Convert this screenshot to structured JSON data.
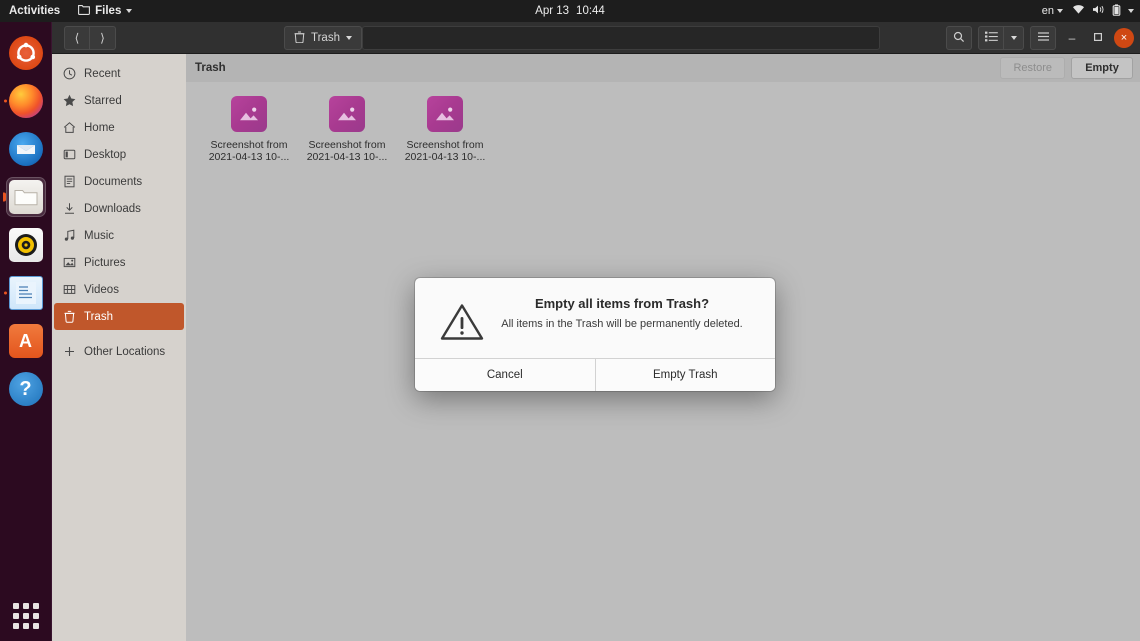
{
  "topbar": {
    "activities": "Activities",
    "app_menu": "Files",
    "app_icon": "folder-icon",
    "clock_date": "Apr 13",
    "clock_time": "10:44",
    "language": "en",
    "tray_icons": [
      "wifi-icon",
      "volume-icon",
      "battery-icon"
    ]
  },
  "dock": {
    "items": [
      {
        "name": "ubuntu-desktop-icon",
        "label": "Ubuntu"
      },
      {
        "name": "firefox-icon",
        "label": "Firefox"
      },
      {
        "name": "thunderbird-icon",
        "label": "Thunderbird"
      },
      {
        "name": "files-icon",
        "label": "Files"
      },
      {
        "name": "rhythmbox-icon",
        "label": "Rhythmbox"
      },
      {
        "name": "libreoffice-writer-icon",
        "label": "LibreOffice Writer"
      },
      {
        "name": "ubuntu-software-icon",
        "label": "Ubuntu Software",
        "glyph": "A"
      },
      {
        "name": "help-icon",
        "label": "Help",
        "glyph": "?"
      }
    ],
    "show_apps_label": "Show Applications"
  },
  "window": {
    "headerbar": {
      "back_icon": "chevron-left-icon",
      "forward_icon": "chevron-right-icon",
      "pathbar_label": "Trash",
      "pathbar_icon": "trash-icon",
      "pathbar_caret": "chevron-down-icon",
      "search_icon": "search-icon",
      "view_list_icon": "list-view-icon",
      "view_caret_icon": "chevron-down-icon",
      "menu_icon": "hamburger-menu-icon",
      "minimize_label": "–",
      "maximize_label": "□",
      "close_label": "×"
    },
    "sidebar": {
      "items": [
        {
          "label": "Recent",
          "icon": "clock-icon",
          "selected": false
        },
        {
          "label": "Starred",
          "icon": "star-icon",
          "selected": false
        },
        {
          "label": "Home",
          "icon": "home-icon",
          "selected": false
        },
        {
          "label": "Desktop",
          "icon": "desktop-icon",
          "selected": false
        },
        {
          "label": "Documents",
          "icon": "documents-icon",
          "selected": false
        },
        {
          "label": "Downloads",
          "icon": "downloads-icon",
          "selected": false
        },
        {
          "label": "Music",
          "icon": "music-icon",
          "selected": false
        },
        {
          "label": "Pictures",
          "icon": "pictures-icon",
          "selected": false
        },
        {
          "label": "Videos",
          "icon": "videos-icon",
          "selected": false
        },
        {
          "label": "Trash",
          "icon": "trash-icon",
          "selected": true
        },
        {
          "label": "Other Locations",
          "icon": "plus-icon",
          "selected": false
        }
      ]
    },
    "content": {
      "title": "Trash",
      "restore_label": "Restore",
      "empty_label": "Empty",
      "files": [
        {
          "name": "Screenshot from 2021-04-13 10-...",
          "icon": "image-file-icon"
        },
        {
          "name": "Screenshot from 2021-04-13 10-...",
          "icon": "image-file-icon"
        },
        {
          "name": "Screenshot from 2021-04-13 10-...",
          "icon": "image-file-icon"
        }
      ]
    }
  },
  "dialog": {
    "icon": "warning-triangle-icon",
    "title": "Empty all items from Trash?",
    "message": "All items in the Trash will be permanently deleted.",
    "cancel_label": "Cancel",
    "confirm_label": "Empty Trash"
  },
  "colors": {
    "accent": "#e95420",
    "selection": "#c0572b",
    "close_button": "#cf4813",
    "file_icon": "#a83a90"
  }
}
